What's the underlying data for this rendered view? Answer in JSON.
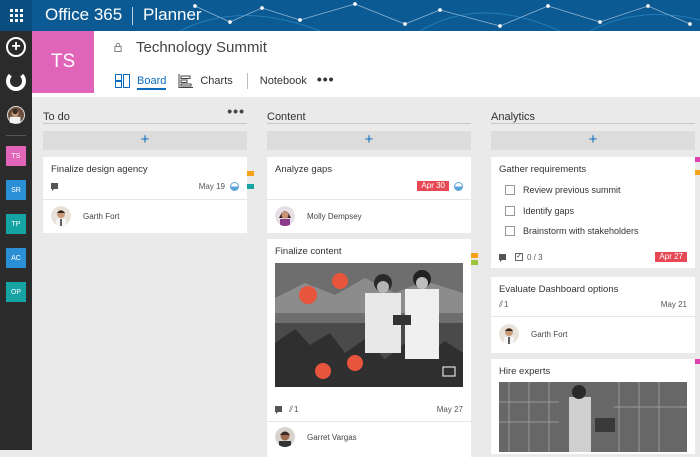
{
  "topbar": {
    "brand": "Office 365",
    "app_name": "Planner",
    "waffle_icon": "app-launcher-icon"
  },
  "rail": {
    "new_plan_icon": "add-circle-icon",
    "hub_icon": "planner-hub-icon",
    "plans": [
      {
        "initials": "TS",
        "color": "#e064b7"
      },
      {
        "initials": "SR",
        "color": "#2b8fd6"
      },
      {
        "initials": "TP",
        "color": "#16a3a3"
      },
      {
        "initials": "AC",
        "color": "#2b8fd6"
      },
      {
        "initials": "OP",
        "color": "#16a3a3"
      }
    ]
  },
  "plan": {
    "initials": "TS",
    "title": "Technology Summit",
    "tile_color": "#e064b7"
  },
  "nav": {
    "board": "Board",
    "charts": "Charts",
    "notebook": "Notebook",
    "more": "•••",
    "active": "Board"
  },
  "buckets": [
    {
      "name": "To do",
      "more": "•••",
      "add": "+",
      "cards": [
        {
          "title": "Finalize design agency",
          "due": "May 19",
          "assignee": "Garth Fort"
        }
      ]
    },
    {
      "name": "Content",
      "add": "+",
      "cards": [
        {
          "title": "Analyze gaps",
          "due": "Apr 30",
          "late": true,
          "assignee": "Molly Dempsey"
        },
        {
          "title": "Finalize content",
          "attachments": "1",
          "due": "May 27",
          "assignee": "Garret Vargas"
        }
      ]
    },
    {
      "name": "Analytics",
      "add": "+",
      "cards": [
        {
          "title": "Gather requirements",
          "checklist": [
            "Review previous summit",
            "Identify gaps",
            "Brainstorm with stakeholders"
          ],
          "checklist_progress": "0 / 3",
          "due": "Apr 27",
          "late": true
        },
        {
          "title": "Evaluate Dashboard options",
          "attachments": "1",
          "due": "May 21",
          "assignee": "Garth Fort"
        },
        {
          "title": "Hire experts"
        }
      ]
    }
  ],
  "colors": {
    "accent": "#0b6cbf",
    "late": "#e74856",
    "label_orange": "#f7a21b",
    "label_teal": "#16a3a3",
    "label_pink": "#e040b0"
  }
}
